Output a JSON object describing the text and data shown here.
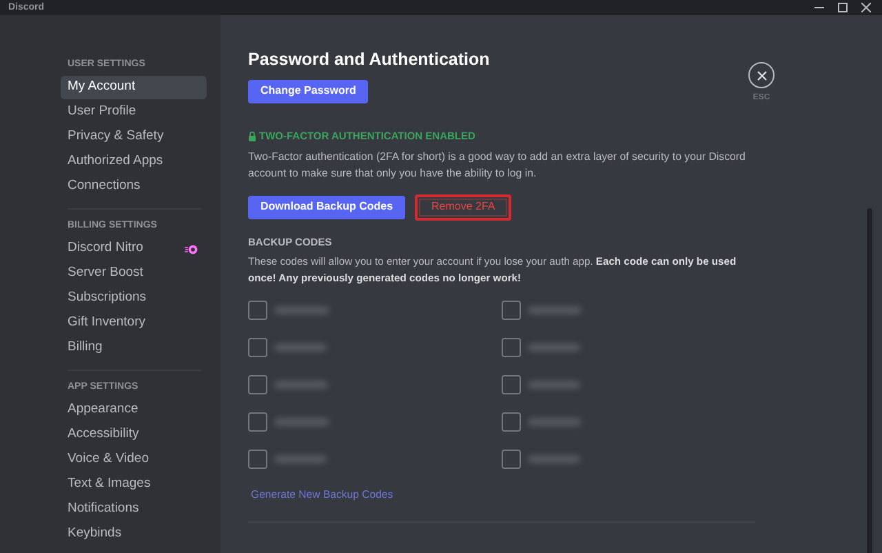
{
  "window": {
    "title": "Discord"
  },
  "sidebar": {
    "sections": [
      {
        "heading": "USER SETTINGS",
        "items": [
          {
            "label": "My Account",
            "selected": true
          },
          {
            "label": "User Profile",
            "selected": false
          },
          {
            "label": "Privacy & Safety",
            "selected": false
          },
          {
            "label": "Authorized Apps",
            "selected": false
          },
          {
            "label": "Connections",
            "selected": false
          }
        ]
      },
      {
        "heading": "BILLING SETTINGS",
        "items": [
          {
            "label": "Discord Nitro",
            "selected": false,
            "badge": true
          },
          {
            "label": "Server Boost",
            "selected": false
          },
          {
            "label": "Subscriptions",
            "selected": false
          },
          {
            "label": "Gift Inventory",
            "selected": false
          },
          {
            "label": "Billing",
            "selected": false
          }
        ]
      },
      {
        "heading": "APP SETTINGS",
        "items": [
          {
            "label": "Appearance",
            "selected": false
          },
          {
            "label": "Accessibility",
            "selected": false
          },
          {
            "label": "Voice & Video",
            "selected": false
          },
          {
            "label": "Text & Images",
            "selected": false
          },
          {
            "label": "Notifications",
            "selected": false
          },
          {
            "label": "Keybinds",
            "selected": false
          }
        ]
      }
    ]
  },
  "page": {
    "title": "Password and Authentication",
    "change_password": "Change Password",
    "tfa_status": "TWO-FACTOR AUTHENTICATION ENABLED",
    "tfa_description": "Two-Factor authentication (2FA for short) is a good way to add an extra layer of security to your Discord account to make sure that only you have the ability to log in.",
    "download_button": "Download Backup Codes",
    "remove_button": {
      "label": "Remove 2FA",
      "highlighted": true
    },
    "backup_heading": "BACKUP CODES",
    "backup_description": "These codes will allow you to enter your account if you lose your auth app. **Each code can only be used once! Any previously generated codes no longer work!**",
    "codes": [
      {
        "checked": false
      },
      {
        "checked": false
      },
      {
        "checked": false
      },
      {
        "checked": false
      },
      {
        "checked": false
      },
      {
        "checked": false
      },
      {
        "checked": false
      },
      {
        "checked": false
      },
      {
        "checked": false
      },
      {
        "checked": false
      }
    ],
    "generate_link": "Generate New Backup Codes",
    "close": {
      "label": "ESC"
    }
  }
}
